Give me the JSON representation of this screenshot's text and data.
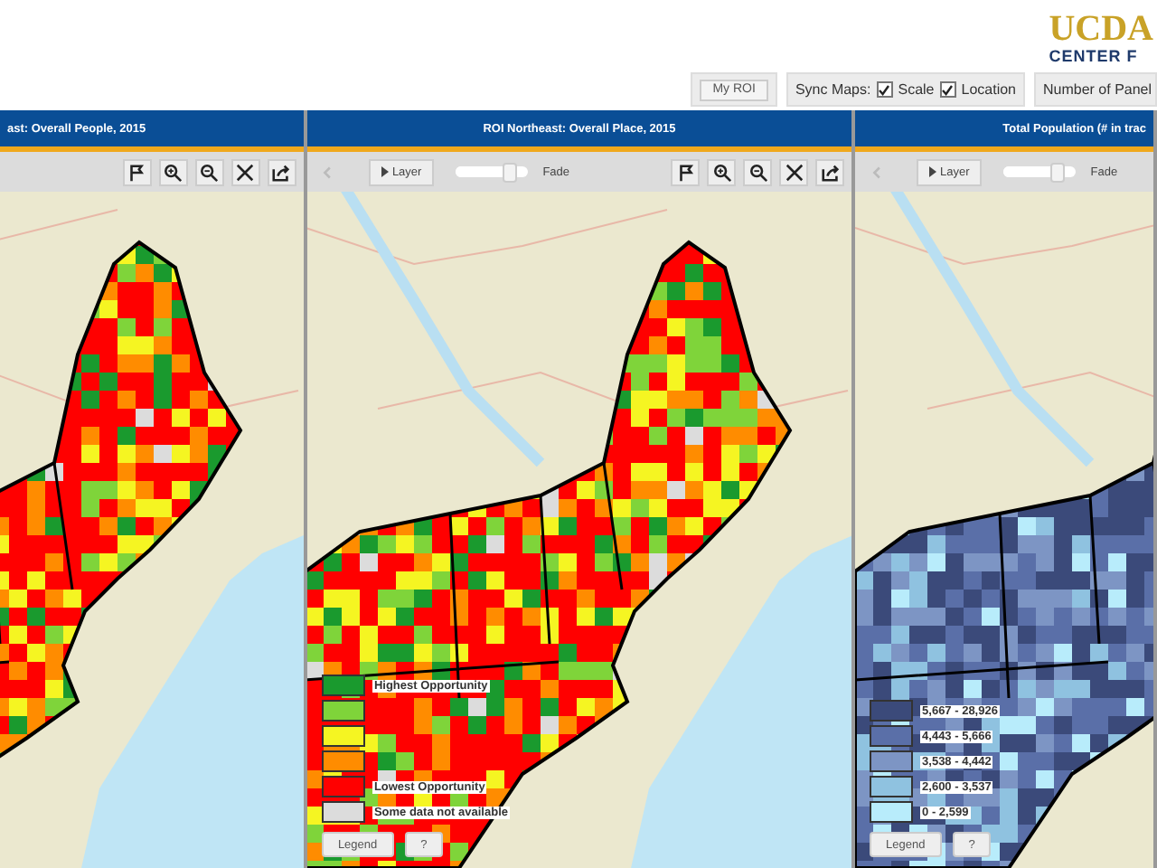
{
  "header": {
    "logo_top": "UCDA",
    "logo_bottom": "CENTER F"
  },
  "controls": {
    "roi_button": "My ROI",
    "sync_label": "Sync Maps:",
    "sync_options": [
      {
        "label": "Scale",
        "checked": true
      },
      {
        "label": "Location",
        "checked": true
      }
    ],
    "panels_label": "Number of Panel"
  },
  "panels": [
    {
      "title": "ast: Overall People, 2015",
      "toolbar": [
        {
          "kind": "flag"
        },
        {
          "kind": "zoom-in"
        },
        {
          "kind": "zoom-out"
        },
        {
          "kind": "extent"
        },
        {
          "kind": "share"
        }
      ]
    },
    {
      "title": "ROI Northeast: Overall Place, 2015",
      "toolbar": [
        {
          "kind": "back",
          "disabled": true
        },
        {
          "kind": "layer",
          "label": "Layer"
        },
        {
          "kind": "slider",
          "level": 0.85
        },
        {
          "kind": "text",
          "label": "Fade"
        },
        {
          "kind": "flag"
        },
        {
          "kind": "zoom-in"
        },
        {
          "kind": "zoom-out"
        },
        {
          "kind": "extent"
        },
        {
          "kind": "share"
        }
      ],
      "legend": [
        {
          "color": "#1a9a2e",
          "label": "Highest Opportunity"
        },
        {
          "color": "#7fd43a"
        },
        {
          "color": "#f5f522"
        },
        {
          "color": "#ff8c00"
        },
        {
          "color": "#ff0000",
          "label": "Lowest Opportunity"
        },
        {
          "color": "#dcdcdc",
          "label": "Some data not available"
        }
      ],
      "legend_button": "Legend",
      "help_button": "?"
    },
    {
      "title": "Total Population (# in trac",
      "toolbar": [
        {
          "kind": "back",
          "disabled": true
        },
        {
          "kind": "layer",
          "label": "Layer"
        },
        {
          "kind": "slider",
          "level": 0.85
        },
        {
          "kind": "text",
          "label": "Fade"
        }
      ],
      "legend": [
        {
          "color": "#3b4a7a",
          "label": "5,667 - 28,926"
        },
        {
          "color": "#5a6fa8",
          "label": "4,443 - 5,666"
        },
        {
          "color": "#7d95c4",
          "label": "3,538 - 4,442"
        },
        {
          "color": "#8fc2e0",
          "label": "2,600 - 3,537"
        },
        {
          "color": "#b8ecfb",
          "label": "0 - 2,599"
        }
      ],
      "legend_button": "Legend",
      "help_button": "?"
    }
  ]
}
